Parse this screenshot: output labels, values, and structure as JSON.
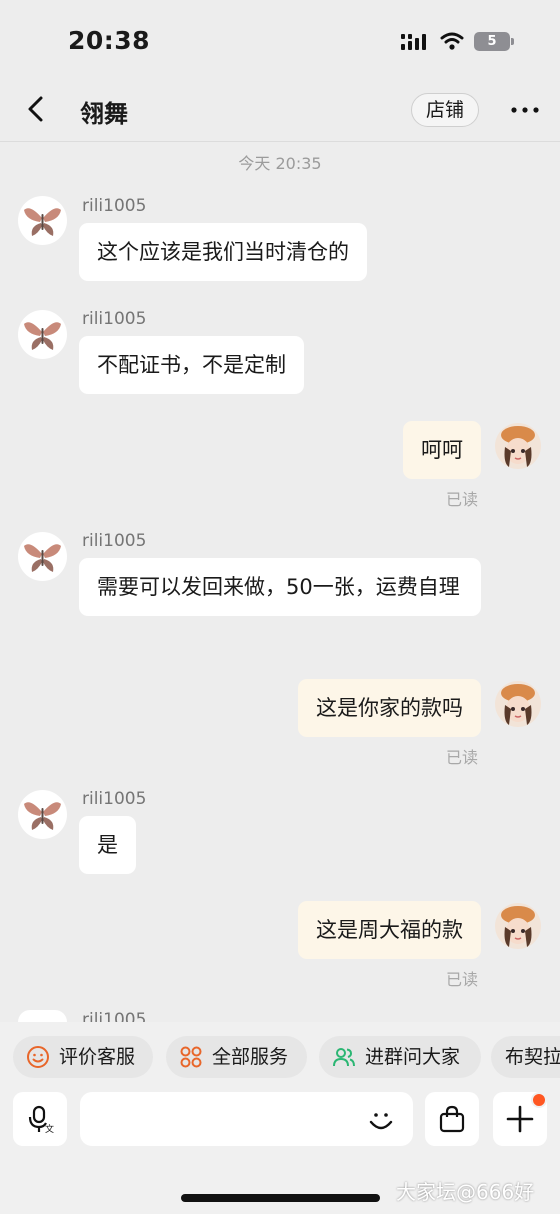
{
  "status": {
    "time": "20:38",
    "battery": "5"
  },
  "nav": {
    "title": "翎舞",
    "shop_button": "店铺"
  },
  "chat": {
    "timestamp": "今天 20:35",
    "messages": [
      {
        "sender": "rili1005",
        "text": "这个应该是我们当时清仓的"
      },
      {
        "sender": "rili1005",
        "text": "不配证书，不是定制"
      },
      {
        "text": "呵呵",
        "status": "已读"
      },
      {
        "sender": "rili1005",
        "text": "需要可以发回来做，50一张，运费自理"
      },
      {
        "text": "这是你家的款吗",
        "status": "已读"
      },
      {
        "sender": "rili1005",
        "text": "是"
      },
      {
        "text": "这是周大福的款",
        "status": "已读"
      },
      {
        "sender": "rili1005"
      }
    ]
  },
  "quick_actions": [
    {
      "label": "评价客服",
      "icon": "smile-icon"
    },
    {
      "label": "全部服务",
      "icon": "services-icon"
    },
    {
      "label": "进群问大家",
      "icon": "group-icon"
    },
    {
      "label": "布契拉",
      "icon": ""
    }
  ],
  "input_bar": {
    "voice_icon": "mic-icon",
    "emoji_icon": "emoji-icon",
    "bag_icon": "shopping-bag-icon",
    "plus_icon": "plus-icon"
  },
  "watermark": "大家坛@666好",
  "colors": {
    "accent": "#e8662a",
    "group_icon": "#2bb673",
    "outgoing_bubble": "#fdf6e3",
    "incoming_bubble": "#ffffff",
    "badge": "#ff5722"
  }
}
